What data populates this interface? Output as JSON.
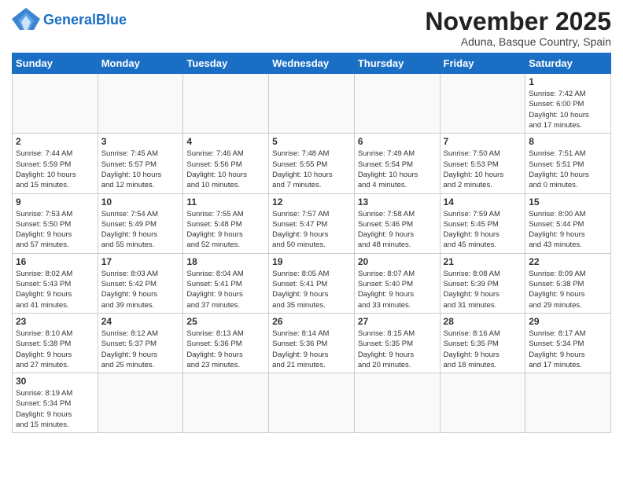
{
  "header": {
    "logo_general": "General",
    "logo_blue": "Blue",
    "month_title": "November 2025",
    "location": "Aduna, Basque Country, Spain"
  },
  "weekdays": [
    "Sunday",
    "Monday",
    "Tuesday",
    "Wednesday",
    "Thursday",
    "Friday",
    "Saturday"
  ],
  "weeks": [
    [
      {
        "day": "",
        "info": ""
      },
      {
        "day": "",
        "info": ""
      },
      {
        "day": "",
        "info": ""
      },
      {
        "day": "",
        "info": ""
      },
      {
        "day": "",
        "info": ""
      },
      {
        "day": "",
        "info": ""
      },
      {
        "day": "1",
        "info": "Sunrise: 7:42 AM\nSunset: 6:00 PM\nDaylight: 10 hours\nand 17 minutes."
      }
    ],
    [
      {
        "day": "2",
        "info": "Sunrise: 7:44 AM\nSunset: 5:59 PM\nDaylight: 10 hours\nand 15 minutes."
      },
      {
        "day": "3",
        "info": "Sunrise: 7:45 AM\nSunset: 5:57 PM\nDaylight: 10 hours\nand 12 minutes."
      },
      {
        "day": "4",
        "info": "Sunrise: 7:46 AM\nSunset: 5:56 PM\nDaylight: 10 hours\nand 10 minutes."
      },
      {
        "day": "5",
        "info": "Sunrise: 7:48 AM\nSunset: 5:55 PM\nDaylight: 10 hours\nand 7 minutes."
      },
      {
        "day": "6",
        "info": "Sunrise: 7:49 AM\nSunset: 5:54 PM\nDaylight: 10 hours\nand 4 minutes."
      },
      {
        "day": "7",
        "info": "Sunrise: 7:50 AM\nSunset: 5:53 PM\nDaylight: 10 hours\nand 2 minutes."
      },
      {
        "day": "8",
        "info": "Sunrise: 7:51 AM\nSunset: 5:51 PM\nDaylight: 10 hours\nand 0 minutes."
      }
    ],
    [
      {
        "day": "9",
        "info": "Sunrise: 7:53 AM\nSunset: 5:50 PM\nDaylight: 9 hours\nand 57 minutes."
      },
      {
        "day": "10",
        "info": "Sunrise: 7:54 AM\nSunset: 5:49 PM\nDaylight: 9 hours\nand 55 minutes."
      },
      {
        "day": "11",
        "info": "Sunrise: 7:55 AM\nSunset: 5:48 PM\nDaylight: 9 hours\nand 52 minutes."
      },
      {
        "day": "12",
        "info": "Sunrise: 7:57 AM\nSunset: 5:47 PM\nDaylight: 9 hours\nand 50 minutes."
      },
      {
        "day": "13",
        "info": "Sunrise: 7:58 AM\nSunset: 5:46 PM\nDaylight: 9 hours\nand 48 minutes."
      },
      {
        "day": "14",
        "info": "Sunrise: 7:59 AM\nSunset: 5:45 PM\nDaylight: 9 hours\nand 45 minutes."
      },
      {
        "day": "15",
        "info": "Sunrise: 8:00 AM\nSunset: 5:44 PM\nDaylight: 9 hours\nand 43 minutes."
      }
    ],
    [
      {
        "day": "16",
        "info": "Sunrise: 8:02 AM\nSunset: 5:43 PM\nDaylight: 9 hours\nand 41 minutes."
      },
      {
        "day": "17",
        "info": "Sunrise: 8:03 AM\nSunset: 5:42 PM\nDaylight: 9 hours\nand 39 minutes."
      },
      {
        "day": "18",
        "info": "Sunrise: 8:04 AM\nSunset: 5:41 PM\nDaylight: 9 hours\nand 37 minutes."
      },
      {
        "day": "19",
        "info": "Sunrise: 8:05 AM\nSunset: 5:41 PM\nDaylight: 9 hours\nand 35 minutes."
      },
      {
        "day": "20",
        "info": "Sunrise: 8:07 AM\nSunset: 5:40 PM\nDaylight: 9 hours\nand 33 minutes."
      },
      {
        "day": "21",
        "info": "Sunrise: 8:08 AM\nSunset: 5:39 PM\nDaylight: 9 hours\nand 31 minutes."
      },
      {
        "day": "22",
        "info": "Sunrise: 8:09 AM\nSunset: 5:38 PM\nDaylight: 9 hours\nand 29 minutes."
      }
    ],
    [
      {
        "day": "23",
        "info": "Sunrise: 8:10 AM\nSunset: 5:38 PM\nDaylight: 9 hours\nand 27 minutes."
      },
      {
        "day": "24",
        "info": "Sunrise: 8:12 AM\nSunset: 5:37 PM\nDaylight: 9 hours\nand 25 minutes."
      },
      {
        "day": "25",
        "info": "Sunrise: 8:13 AM\nSunset: 5:36 PM\nDaylight: 9 hours\nand 23 minutes."
      },
      {
        "day": "26",
        "info": "Sunrise: 8:14 AM\nSunset: 5:36 PM\nDaylight: 9 hours\nand 21 minutes."
      },
      {
        "day": "27",
        "info": "Sunrise: 8:15 AM\nSunset: 5:35 PM\nDaylight: 9 hours\nand 20 minutes."
      },
      {
        "day": "28",
        "info": "Sunrise: 8:16 AM\nSunset: 5:35 PM\nDaylight: 9 hours\nand 18 minutes."
      },
      {
        "day": "29",
        "info": "Sunrise: 8:17 AM\nSunset: 5:34 PM\nDaylight: 9 hours\nand 17 minutes."
      }
    ],
    [
      {
        "day": "30",
        "info": "Sunrise: 8:19 AM\nSunset: 5:34 PM\nDaylight: 9 hours\nand 15 minutes."
      },
      {
        "day": "",
        "info": ""
      },
      {
        "day": "",
        "info": ""
      },
      {
        "day": "",
        "info": ""
      },
      {
        "day": "",
        "info": ""
      },
      {
        "day": "",
        "info": ""
      },
      {
        "day": "",
        "info": ""
      }
    ]
  ]
}
